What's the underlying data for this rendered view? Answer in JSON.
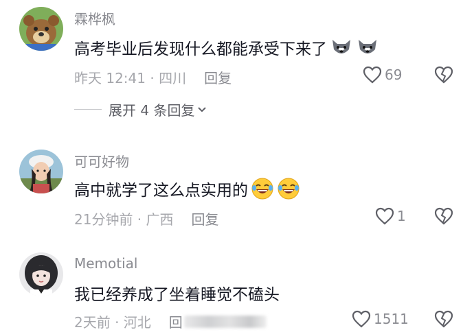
{
  "comments": [
    {
      "username": "霖桦枫",
      "content": "高考毕业后发现什么都能承受下来了",
      "time_location": "昨天 12:41 · 四川",
      "reply_label": "回复",
      "likes": "69",
      "emojis": [
        "wolf-face-emoji",
        "wolf-face-emoji"
      ]
    },
    {
      "username": "可可好物",
      "content": "高中就学了这么点实用的",
      "time_location": "21分钟前 · 广西",
      "reply_label": "回复",
      "likes": "1",
      "emojis": [
        "laughing-tears-emoji",
        "laughing-tears-emoji"
      ]
    },
    {
      "username": "Memotial",
      "content": "我已经养成了坐着睡觉不磕头",
      "time_location": "2天前 · 河北",
      "reply_label": "回",
      "likes": "1511",
      "emojis": []
    }
  ],
  "expand_replies_label": "展开 4 条回复",
  "colors": {
    "secondary_text": "#8a8b91",
    "meta_text": "#a6a7ac",
    "primary_text": "#161823"
  }
}
